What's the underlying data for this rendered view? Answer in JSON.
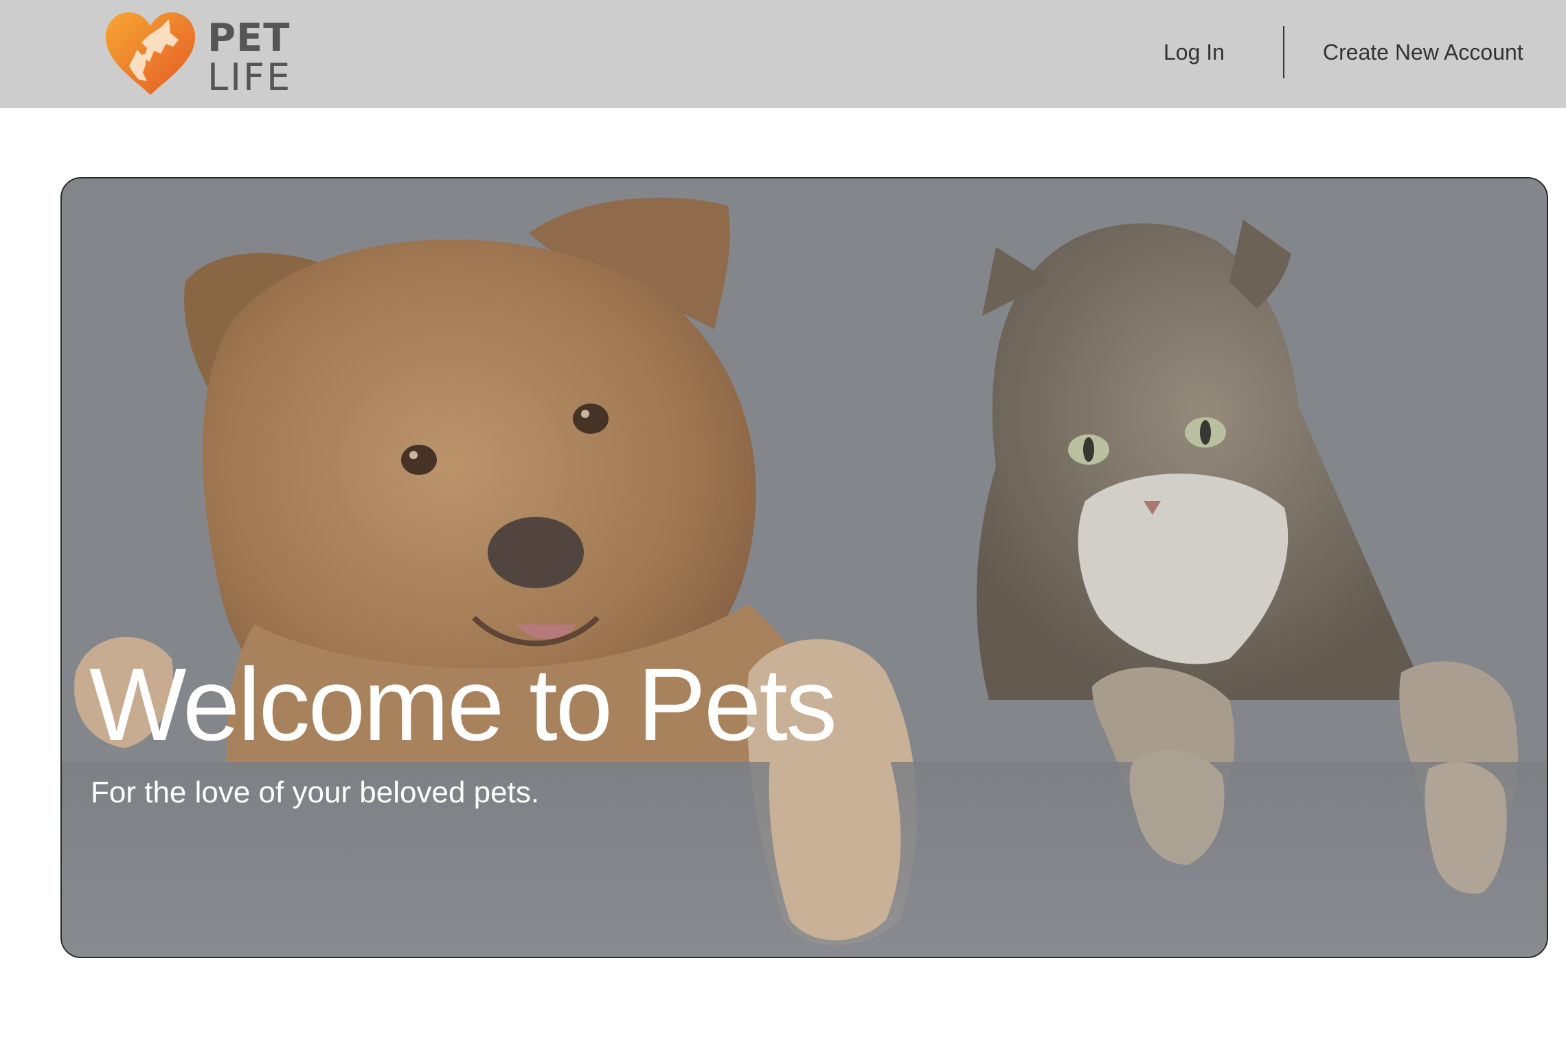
{
  "header": {
    "logo": {
      "line1": "PET",
      "line2": "LIFE",
      "icon": "heart-dog-cat-icon",
      "colors": [
        "#f29a2e",
        "#e8652a"
      ]
    },
    "nav": {
      "login_label": "Log In",
      "create_account_label": "Create New Account"
    },
    "background": "#cdcdcd"
  },
  "hero": {
    "title": "Welcome to Pets",
    "subtitle": "For the love of your beloved pets.",
    "image": "dog-and-cat-photo"
  }
}
